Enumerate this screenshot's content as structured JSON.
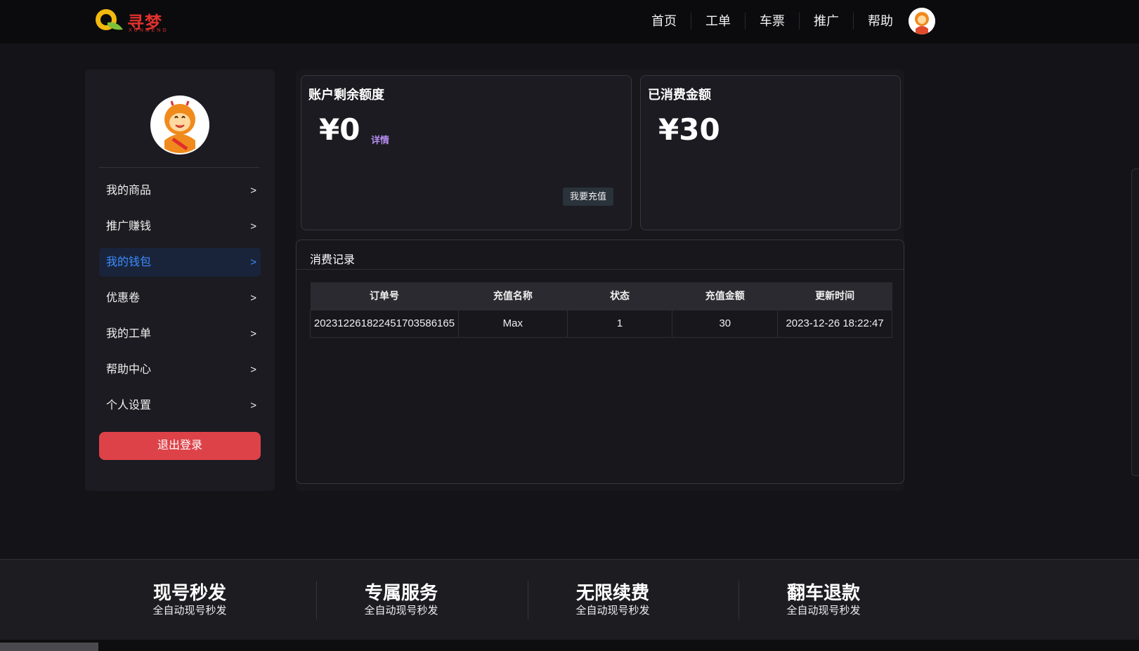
{
  "brand": {
    "name": "寻梦",
    "sub": "XUNMENG"
  },
  "nav": {
    "items": [
      {
        "label": "首页"
      },
      {
        "label": "工单"
      },
      {
        "label": "车票"
      },
      {
        "label": "推广"
      },
      {
        "label": "帮助"
      }
    ]
  },
  "sidebar": {
    "items": [
      {
        "label": "我的商品",
        "arrow": ">"
      },
      {
        "label": "推广赚钱",
        "arrow": ">"
      },
      {
        "label": "我的钱包",
        "arrow": ">",
        "active": true
      },
      {
        "label": "优惠卷",
        "arrow": ">"
      },
      {
        "label": "我的工单",
        "arrow": ">"
      },
      {
        "label": "帮助中心",
        "arrow": ">"
      },
      {
        "label": "个人设置",
        "arrow": ">"
      }
    ],
    "logout_label": "退出登录"
  },
  "balance": {
    "title": "账户剩余额度",
    "amount": "¥0",
    "detail_label": "详情",
    "recharge_label": "我要充值"
  },
  "spent": {
    "title": "已消费金额",
    "amount": "¥30"
  },
  "records": {
    "title": "消费记录",
    "columns": [
      "订单号",
      "充值名称",
      "状态",
      "充值金额",
      "更新时间"
    ],
    "rows": [
      [
        "20231226182245170358616​5",
        "Max",
        "1",
        "30",
        "2023-12-26 18:22:47"
      ]
    ]
  },
  "features": [
    {
      "title": "现号秒发",
      "sub": "全自动现号秒发"
    },
    {
      "title": "专属服务",
      "sub": "全自动现号秒发"
    },
    {
      "title": "无限续费",
      "sub": "全自动现号秒发"
    },
    {
      "title": "翻车退款",
      "sub": "全自动现号秒发"
    }
  ],
  "colors": {
    "accent": "#3d8bff",
    "logout": "#dd4248",
    "detail": "#b58cf0",
    "brand": "#e0312d"
  }
}
